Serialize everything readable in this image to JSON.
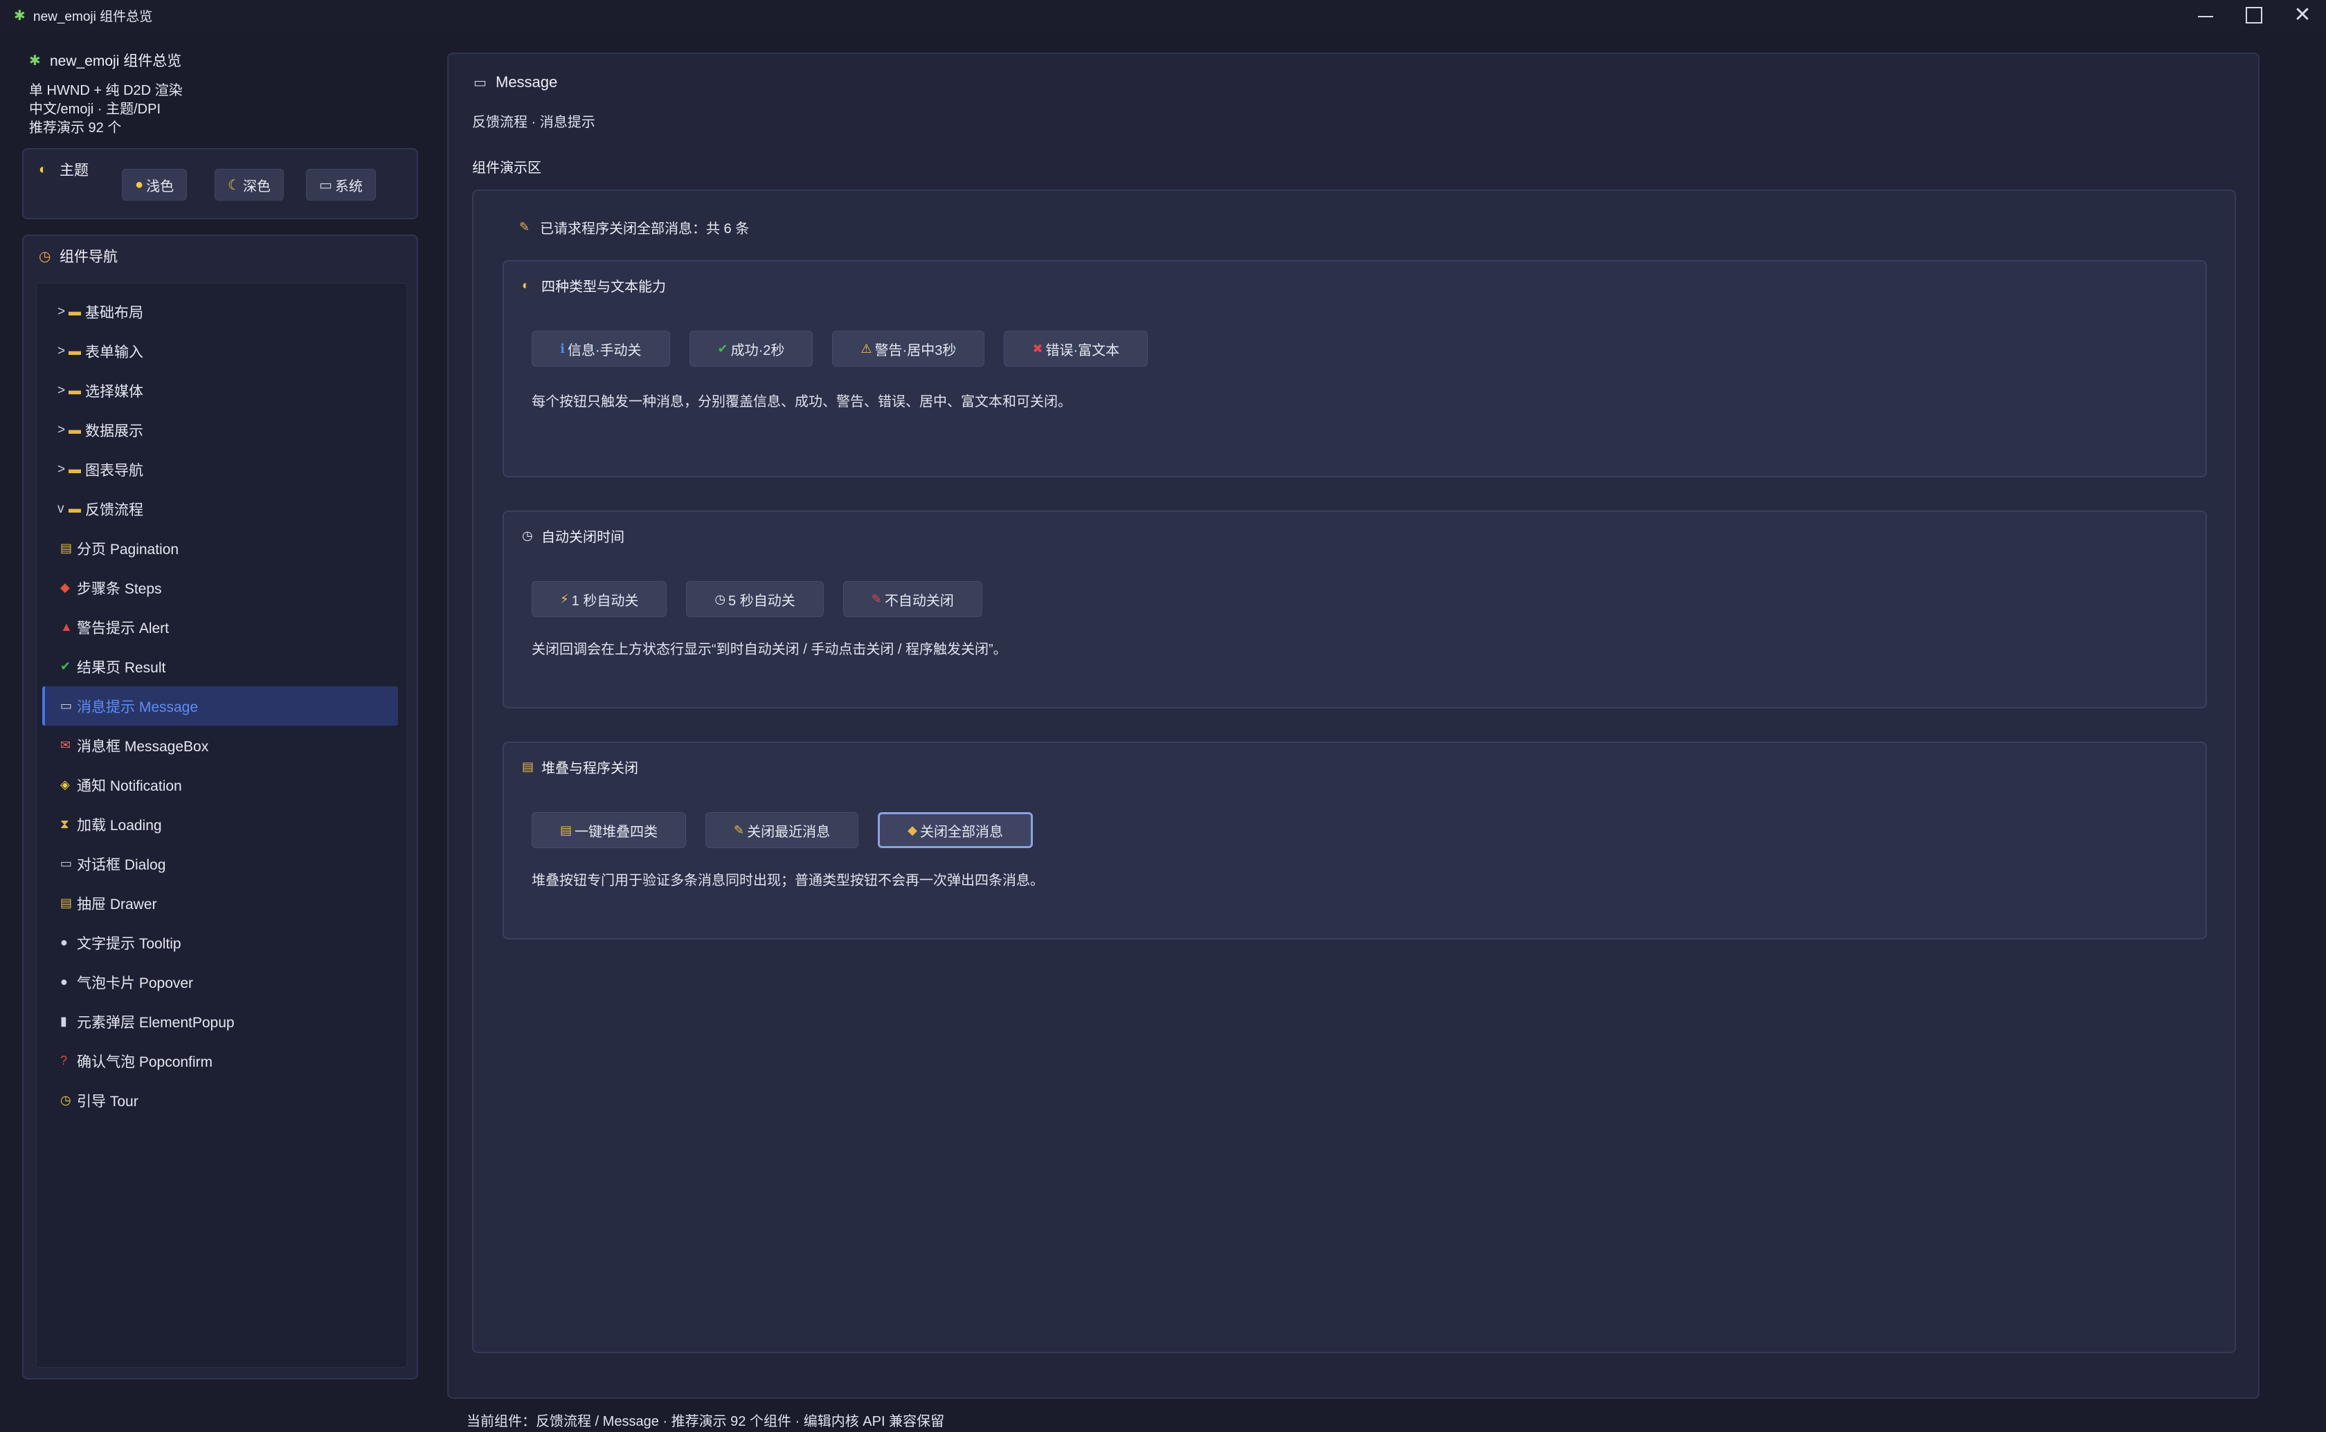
{
  "window": {
    "icon": "puzzle-icon",
    "title": "new_emoji 组件总览",
    "minimize": "minimize-icon",
    "maximize": "maximize-icon",
    "close": "close-icon"
  },
  "sidebar": {
    "app_name": "new_emoji 组件总览",
    "info": [
      "单 HWND + 纯 D2D 渲染",
      "中文/emoji · 主题/DPI",
      "推荐演示 92 个"
    ],
    "theme": {
      "label": "主题",
      "buttons": [
        {
          "icon": "●",
          "label": "浅色"
        },
        {
          "icon": "☾",
          "label": "深色"
        },
        {
          "icon": "▭",
          "label": "系统"
        }
      ]
    },
    "nav": {
      "label": "组件导航",
      "groups": [
        {
          "caret": ">",
          "label": "基础布局"
        },
        {
          "caret": ">",
          "label": "表单输入"
        },
        {
          "caret": ">",
          "label": "选择媒体"
        },
        {
          "caret": ">",
          "label": "数据展示"
        },
        {
          "caret": ">",
          "label": "图表导航"
        },
        {
          "caret": "v",
          "label": "反馈流程"
        }
      ],
      "children": [
        {
          "icon": "▤",
          "label": "分页 Pagination",
          "color": "#e8b84a"
        },
        {
          "icon": "◆",
          "label": "步骤条 Steps",
          "color": "#e0533f"
        },
        {
          "icon": "▲",
          "label": "警告提示 Alert",
          "color": "#e04848"
        },
        {
          "icon": "✔",
          "label": "结果页 Result",
          "color": "#3fb950"
        },
        {
          "icon": "▭",
          "label": "消息提示 Message",
          "color": "#cfd3e2"
        },
        {
          "icon": "✉",
          "label": "消息框 MessageBox",
          "color": "#e06a6a"
        },
        {
          "icon": "◈",
          "label": "通知 Notification",
          "color": "#f2c94c"
        },
        {
          "icon": "⧗",
          "label": "加载 Loading",
          "color": "#e8b84a"
        },
        {
          "icon": "▭",
          "label": "对话框 Dialog",
          "color": "#cfd3e2"
        },
        {
          "icon": "▤",
          "label": "抽屉 Drawer",
          "color": "#e8b84a"
        },
        {
          "icon": "●",
          "label": "文字提示 Tooltip",
          "color": "#cfd3e2"
        },
        {
          "icon": "●",
          "label": "气泡卡片 Popover",
          "color": "#cfd3e2"
        },
        {
          "icon": "▮",
          "label": "元素弹层 ElementPopup",
          "color": "#cfd3e2"
        },
        {
          "icon": "?",
          "label": "确认气泡 Popconfirm",
          "color": "#e04848"
        },
        {
          "icon": "◷",
          "label": "引导 Tour",
          "color": "#f2c94c"
        }
      ],
      "active_label": "消息提示 Message"
    }
  },
  "main": {
    "title": "Message",
    "title_icon": "message-icon",
    "breadcrumb": "反馈流程 · 消息提示",
    "demo_label": "组件演示区",
    "status": "已请求程序关闭全部消息：共 6 条",
    "cards": [
      {
        "title": "四种类型与文本能力",
        "icon": "◐",
        "icon_color": "#f2c94c",
        "buttons": [
          {
            "icon": "ℹ",
            "icon_color": "#4a90e2",
            "label": "信息·手动关"
          },
          {
            "icon": "✔",
            "icon_color": "#3fb950",
            "label": "成功·2秒"
          },
          {
            "icon": "⚠",
            "icon_color": "#f2c94c",
            "label": "警告·居中3秒"
          },
          {
            "icon": "✖",
            "icon_color": "#e04848",
            "label": "错误·富文本"
          }
        ],
        "desc": "每个按钮只触发一种消息，分别覆盖信息、成功、警告、错误、居中、富文本和可关闭。"
      },
      {
        "title": "自动关闭时间",
        "icon": "◷",
        "icon_color": "#e6e8f2",
        "buttons": [
          {
            "icon": "⚡",
            "icon_color": "#f2c94c",
            "label": "1 秒自动关"
          },
          {
            "icon": "◷",
            "icon_color": "#e6e8f2",
            "label": "5 秒自动关"
          },
          {
            "icon": "✎",
            "icon_color": "#e04848",
            "label": "不自动关闭"
          }
        ],
        "desc": "关闭回调会在上方状态行显示“到时自动关闭 / 手动点击关闭 / 程序触发关闭”。"
      },
      {
        "title": "堆叠与程序关闭",
        "icon": "▤",
        "icon_color": "#e8b84a",
        "buttons": [
          {
            "icon": "▤",
            "icon_color": "#e8b84a",
            "label": "一键堆叠四类"
          },
          {
            "icon": "✎",
            "icon_color": "#e8b84a",
            "label": "关闭最近消息"
          },
          {
            "icon": "◆",
            "icon_color": "#e8b84a",
            "label": "关闭全部消息"
          }
        ],
        "desc": "堆叠按钮专门用于验证多条消息同时出现；普通类型按钮不会再一次弹出四条消息。"
      }
    ]
  },
  "footer": {
    "status": "当前组件：反馈流程 / Message · 推荐演示 92 个组件 · 编辑内核 API 兼容保留"
  }
}
